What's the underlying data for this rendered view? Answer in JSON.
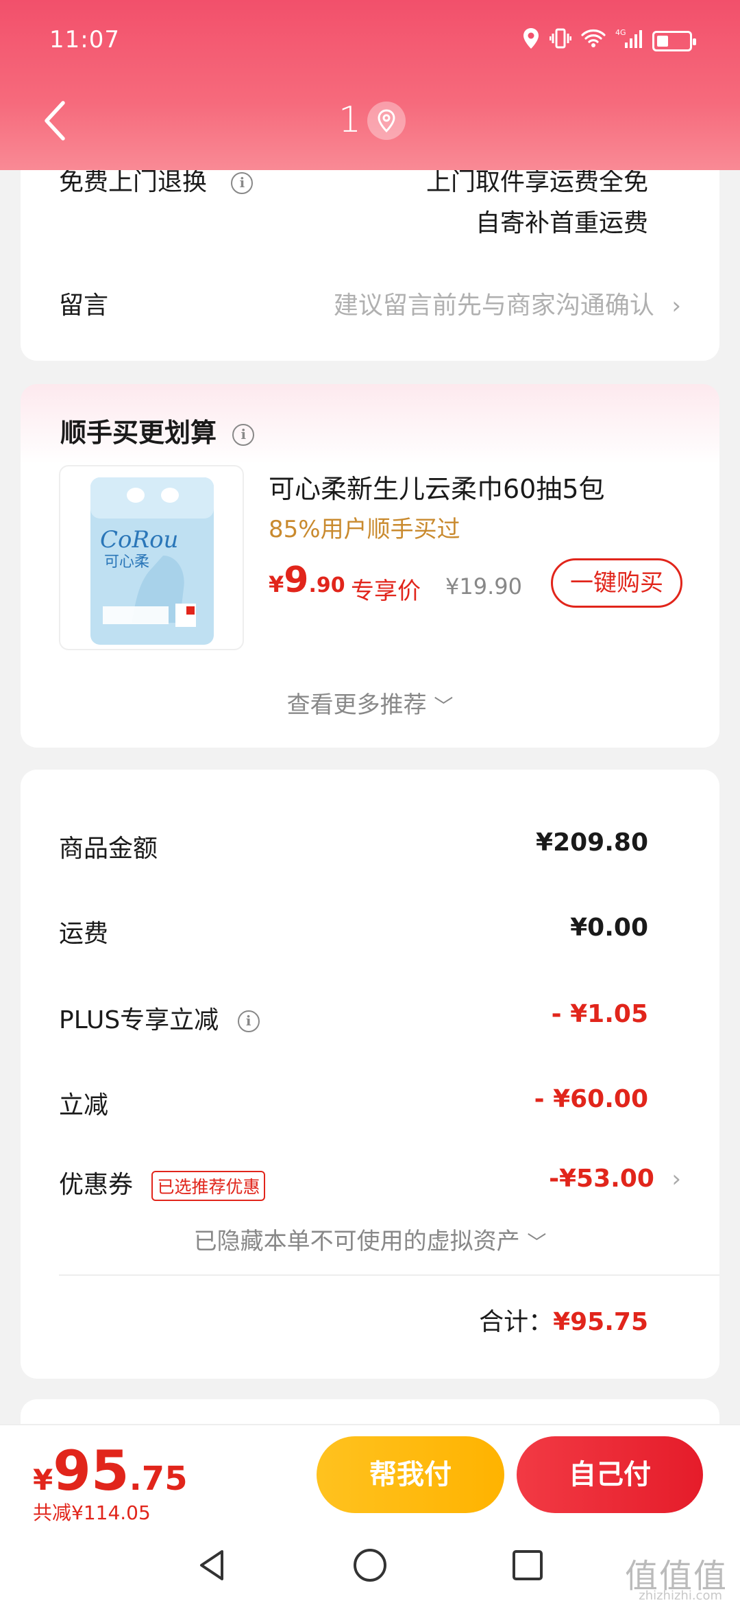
{
  "status_bar": {
    "time": "11:07",
    "network": "4G"
  },
  "header": {
    "title": "1"
  },
  "delivery_card": {
    "return_label": "免费上门退换",
    "return_value_line1": "上门取件享运费全免",
    "return_value_line2": "自寄补首重运费",
    "message_label": "留言",
    "message_placeholder": "建议留言前先与商家沟通确认"
  },
  "recommend": {
    "title": "顺手买更划算",
    "product_name": "可心柔新生儿云柔巾60抽5包",
    "product_tag": "85%用户顺手买过",
    "price_symbol": "¥",
    "price_int": "9",
    "price_dec": ".90",
    "price_label": "专享价",
    "original_price": "¥19.90",
    "buy_button": "一键购买",
    "more_label": "查看更多推荐",
    "product_brand": "CoRou",
    "product_brand_cn": "可心柔"
  },
  "summary": {
    "rows": [
      {
        "label": "商品金额",
        "value": "¥209.80"
      },
      {
        "label": "运费",
        "value": "¥0.00"
      },
      {
        "label": "PLUS专享立减",
        "value": "- ¥1.05"
      },
      {
        "label": "立减",
        "value": "- ¥60.00"
      },
      {
        "label": "优惠券",
        "value": "-¥53.00",
        "badge": "已选推荐优惠"
      }
    ],
    "hidden_assets": "已隐藏本单不可使用的虚拟资产",
    "total_label": "合计：",
    "total_value": "¥95.75"
  },
  "bottom_bar": {
    "price_symbol": "¥",
    "price_int": "95",
    "price_dec": ".75",
    "saved": "共减¥114.05",
    "help_pay": "帮我付",
    "self_pay": "自己付"
  },
  "watermark": {
    "main": "值值值",
    "sub": "zhizhizhi.com"
  },
  "colors": {
    "accent_red": "#e1251b",
    "header_pink": "#f2506b",
    "tag_gold": "#c98a2e",
    "help_yellow": "#ffc21f"
  }
}
